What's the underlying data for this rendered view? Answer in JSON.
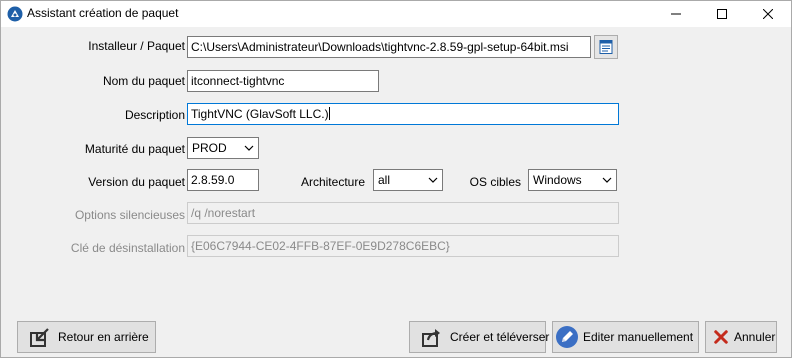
{
  "window": {
    "title": "Assistant création de paquet"
  },
  "form": {
    "installer": {
      "label": "Installeur / Paquet",
      "value": "C:\\Users\\Administrateur\\Downloads\\tightvnc-2.8.59-gpl-setup-64bit.msi"
    },
    "package_name": {
      "label": "Nom du paquet",
      "value": "itconnect-tightvnc"
    },
    "description": {
      "label": "Description",
      "value": "TightVNC (GlavSoft LLC.)"
    },
    "maturity": {
      "label": "Maturité du paquet",
      "value": "PROD"
    },
    "version": {
      "label": "Version du paquet",
      "value": "2.8.59.0"
    },
    "architecture": {
      "label": "Architecture",
      "value": "all"
    },
    "target_os": {
      "label": "OS cibles",
      "value": "Windows"
    },
    "silent_options": {
      "label": "Options silencieuses",
      "value": "/q /norestart"
    },
    "uninstall_key": {
      "label": "Clé de désinstallation",
      "value": "{E06C7944-CE02-4FFB-87EF-0E9D278C6EBC}"
    }
  },
  "buttons": {
    "back": "Retour en arrière",
    "create_upload": "Créer et téléverser",
    "edit_manual": "Editer manuellement",
    "cancel": "Annuler"
  },
  "icons": {
    "app": "app-logo-icon",
    "browse": "browse-file-icon",
    "back": "back-arrow-icon",
    "upload": "share-upload-icon",
    "edit": "pencil-icon",
    "cancel": "red-x-icon"
  },
  "colors": {
    "focus_border": "#0078d7",
    "cancel_red": "#c42b1c",
    "edit_blue": "#3b6fc4"
  }
}
